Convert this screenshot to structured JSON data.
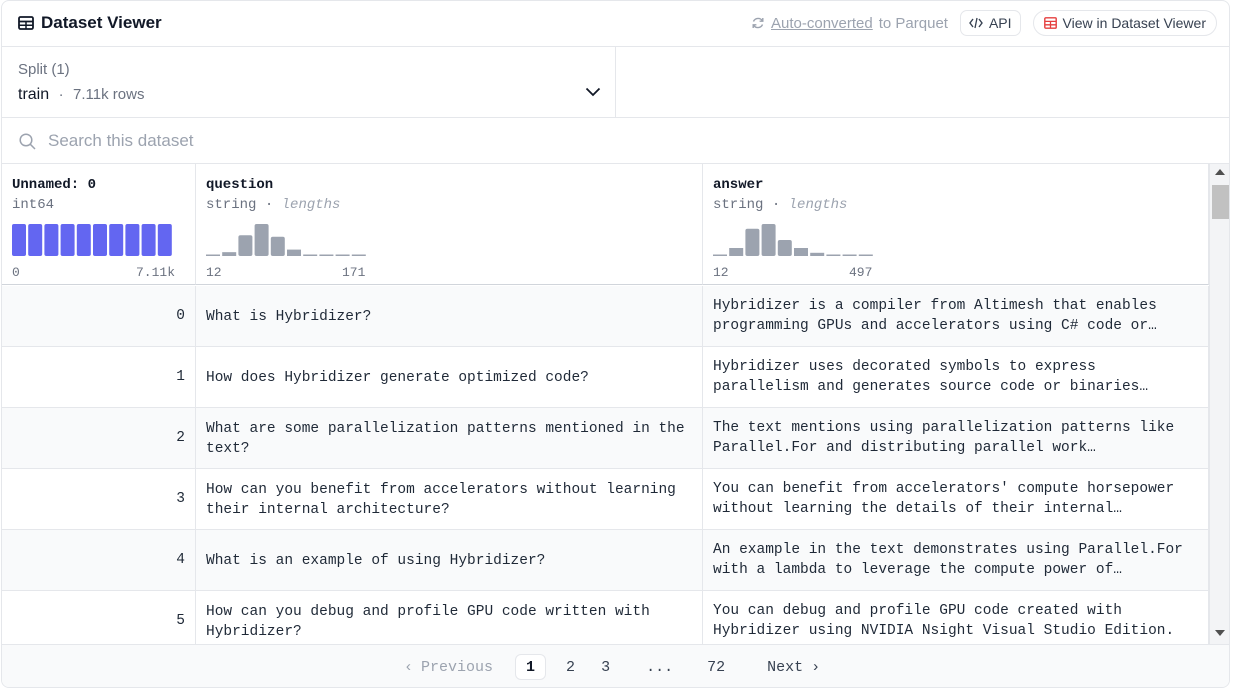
{
  "header": {
    "title": "Dataset Viewer",
    "auto_converted": "Auto-converted",
    "to_parquet": "to Parquet",
    "api_label": "API",
    "view_label": "View in Dataset Viewer"
  },
  "split": {
    "label": "Split (1)",
    "name": "train",
    "separator": "·",
    "rows": "7.11k rows"
  },
  "search": {
    "placeholder": "Search this dataset"
  },
  "columns": [
    {
      "name": "Unnamed: 0",
      "type": "int64",
      "stat": "",
      "range_min": "0",
      "range_max": "7.11k"
    },
    {
      "name": "question",
      "type": "string",
      "stat": "lengths",
      "range_min": "12",
      "range_max": "171"
    },
    {
      "name": "answer",
      "type": "string",
      "stat": "lengths",
      "range_min": "12",
      "range_max": "497"
    }
  ],
  "rows": [
    {
      "idx": "0",
      "question": "What is Hybridizer?",
      "answer": "Hybridizer is a compiler from Altimesh that enables programming GPUs and accelerators using C# code or…"
    },
    {
      "idx": "1",
      "question": "How does Hybridizer generate optimized code?",
      "answer": "Hybridizer uses decorated symbols to express parallelism and generates source code or binaries…"
    },
    {
      "idx": "2",
      "question": "What are some parallelization patterns mentioned in the text?",
      "answer": "The text mentions using parallelization patterns like Parallel.For and distributing parallel work…"
    },
    {
      "idx": "3",
      "question": "How can you benefit from accelerators without learning their internal architecture?",
      "answer": "You can benefit from accelerators' compute horsepower without learning the details of their internal…"
    },
    {
      "idx": "4",
      "question": "What is an example of using Hybridizer?",
      "answer": "An example in the text demonstrates using Parallel.For with a lambda to leverage the compute power of…"
    },
    {
      "idx": "5",
      "question": "How can you debug and profile GPU code written with Hybridizer?",
      "answer": "You can debug and profile GPU code created with Hybridizer using NVIDIA Nsight Visual Studio Edition."
    }
  ],
  "pagination": {
    "previous": "Previous",
    "pages": [
      "1",
      "2",
      "3"
    ],
    "ellipsis": "...",
    "last": "72",
    "next": "Next"
  },
  "histograms": {
    "int64_bar_color": "#6366f1",
    "string_bar_color": "#9ca3af",
    "unnamed_bins": [
      1,
      1,
      1,
      1,
      1,
      1,
      1,
      1,
      1,
      1
    ],
    "question_bins": [
      0.04,
      0.12,
      0.65,
      1.0,
      0.6,
      0.2,
      0.04,
      0.04,
      0.04,
      0.04
    ],
    "answer_bins": [
      0.04,
      0.25,
      0.85,
      1.0,
      0.5,
      0.25,
      0.1,
      0.04,
      0.04,
      0.04
    ]
  }
}
